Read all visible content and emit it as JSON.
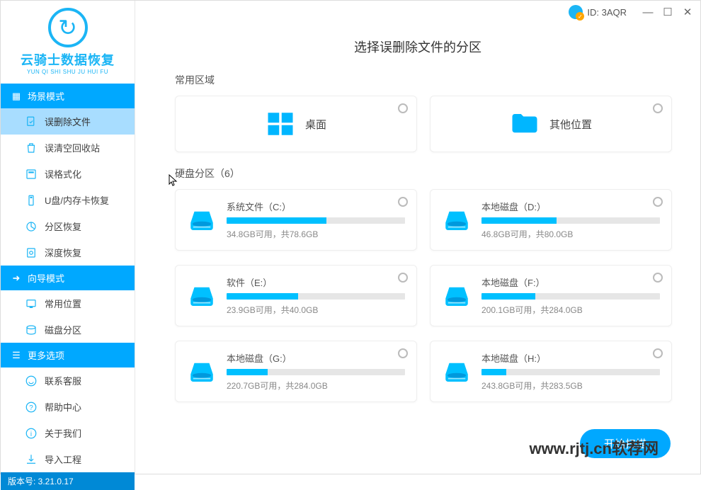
{
  "app": {
    "logo_text": "云骑士数据恢复",
    "logo_sub": "YUN QI SHI SHU JU HUI FU",
    "id_label": "ID: 3AQR",
    "version_label": "版本号: 3.21.0.17"
  },
  "sidebar": {
    "scene_mode": "场景模式",
    "wizard_mode": "向导模式",
    "more_options": "更多选项",
    "items_scene": [
      {
        "label": "误删除文件",
        "icon": "file-restore-icon"
      },
      {
        "label": "误清空回收站",
        "icon": "recycle-bin-icon"
      },
      {
        "label": "误格式化",
        "icon": "format-icon"
      },
      {
        "label": "U盘/内存卡恢复",
        "icon": "usb-icon"
      },
      {
        "label": "分区恢复",
        "icon": "partition-icon"
      },
      {
        "label": "深度恢复",
        "icon": "deep-icon"
      }
    ],
    "items_wizard": [
      {
        "label": "常用位置",
        "icon": "location-icon"
      },
      {
        "label": "磁盘分区",
        "icon": "disk-icon"
      }
    ],
    "items_more": [
      {
        "label": "联系客服",
        "icon": "support-icon"
      },
      {
        "label": "帮助中心",
        "icon": "help-icon"
      },
      {
        "label": "关于我们",
        "icon": "info-icon"
      },
      {
        "label": "导入工程",
        "icon": "import-icon"
      }
    ]
  },
  "main": {
    "page_title": "选择误删除文件的分区",
    "common_region": "常用区域",
    "disk_region": "硬盘分区（6）",
    "desktop": "桌面",
    "other_location": "其他位置",
    "scan_button": "开始扫描",
    "drives": [
      {
        "name": "系统文件（C:）",
        "free": "34.8GB可用，共78.6GB",
        "pct": 56
      },
      {
        "name": "本地磁盘（D:）",
        "free": "46.8GB可用，共80.0GB",
        "pct": 42
      },
      {
        "name": "软件（E:）",
        "free": "23.9GB可用，共40.0GB",
        "pct": 40
      },
      {
        "name": "本地磁盘（F:）",
        "free": "200.1GB可用，共284.0GB",
        "pct": 30
      },
      {
        "name": "本地磁盘（G:）",
        "free": "220.7GB可用，共284.0GB",
        "pct": 23
      },
      {
        "name": "本地磁盘（H:）",
        "free": "243.8GB可用，共283.5GB",
        "pct": 14
      }
    ]
  },
  "watermark": "www.rjtj.cn软荐网"
}
